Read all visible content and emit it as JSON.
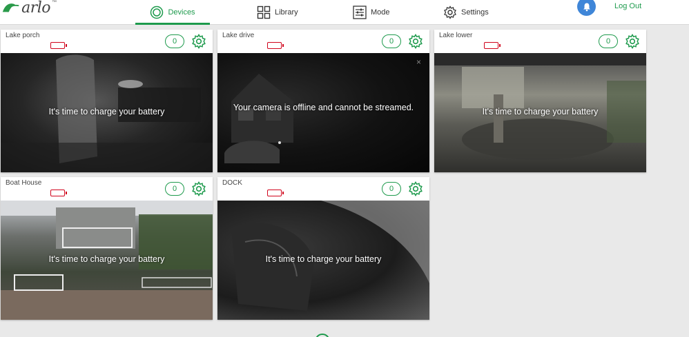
{
  "app": {
    "logo_text": "arlo",
    "logo_tm": "™"
  },
  "nav": {
    "devices": "Devices",
    "library": "Library",
    "mode": "Mode",
    "settings": "Settings",
    "logout": "Log Out"
  },
  "colors": {
    "accent": "#1d9a4c",
    "battery_low": "#d0021b",
    "bell": "#3f86d8"
  },
  "cameras": [
    {
      "name": "Lake porch",
      "count": "0",
      "message": "It's time to charge your battery"
    },
    {
      "name": "Lake drive",
      "count": "0",
      "message": "Your camera is offline and cannot be streamed."
    },
    {
      "name": "Lake lower",
      "count": "0",
      "message": "It's time to charge your battery"
    },
    {
      "name": "Boat House",
      "count": "0",
      "message": "It's time to charge your battery"
    },
    {
      "name": "DOCK",
      "count": "0",
      "message": "It's time to charge your battery"
    }
  ],
  "icons": {
    "close": "×"
  }
}
